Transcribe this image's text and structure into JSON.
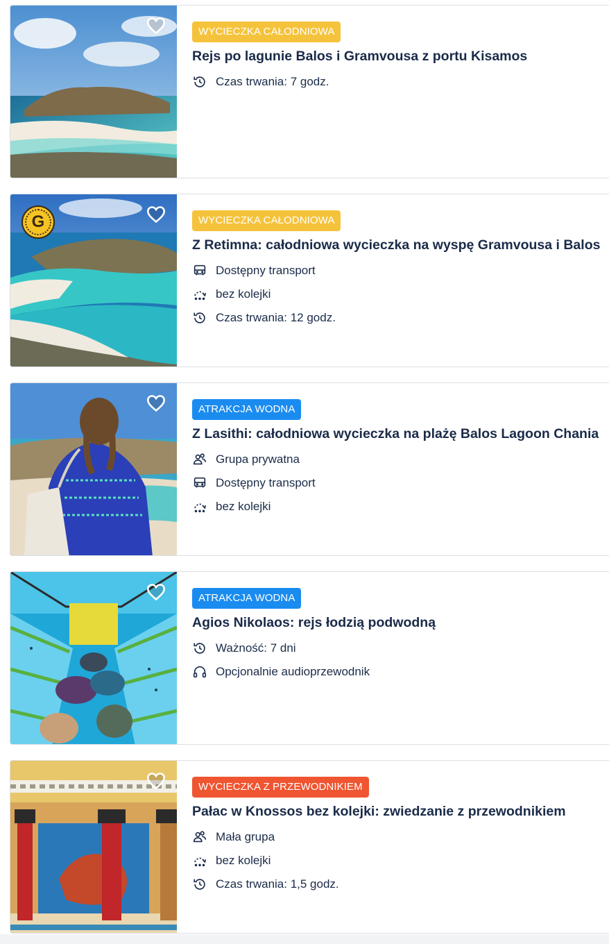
{
  "colors": {
    "tag_yellow": "#f5c33b",
    "tag_blue": "#1a8cf0",
    "tag_red": "#ef5531",
    "text": "#1a2b49"
  },
  "cards": [
    {
      "category": "WYCIECZKA CAŁODNIOWA",
      "category_color": "yellow",
      "title": "Rejs po lagunie Balos i Gramvousa z portu Kisamos",
      "image": "balos-lagoon-aerial",
      "badge": null,
      "features": [
        {
          "icon": "clock-icon",
          "text": "Czas trwania: 7 godz."
        }
      ]
    },
    {
      "category": "WYCIECZKA CAŁODNIOWA",
      "category_color": "yellow",
      "title": "Z Retimna: całodniowa wycieczka na wyspę Gramvousa i Balos",
      "image": "gramvousa-lagoon-aerial",
      "badge": "G",
      "features": [
        {
          "icon": "bus-icon",
          "text": "Dostępny transport"
        },
        {
          "icon": "skip-line-icon",
          "text": "bez kolejki"
        },
        {
          "icon": "clock-icon",
          "text": "Czas trwania: 12 godz."
        }
      ]
    },
    {
      "category": "ATRAKCJA WODNA",
      "category_color": "blue",
      "title": "Z Lasithi: całodniowa wycieczka na plażę Balos Lagoon Chania",
      "image": "woman-overlooking-balos",
      "badge": null,
      "features": [
        {
          "icon": "group-icon",
          "text": "Grupa prywatna"
        },
        {
          "icon": "bus-icon",
          "text": "Dostępny transport"
        },
        {
          "icon": "skip-line-icon",
          "text": "bez kolejki"
        }
      ]
    },
    {
      "category": "ATRAKCJA WODNA",
      "category_color": "blue",
      "title": "Agios Nikolaos: rejs łodzią podwodną",
      "image": "glass-bottom-boat-interior",
      "badge": null,
      "features": [
        {
          "icon": "clock-icon",
          "text": "Ważność: 7 dni"
        },
        {
          "icon": "headphones-icon",
          "text": "Opcjonalnie audioprzewodnik"
        }
      ]
    },
    {
      "category": "WYCIECZKA Z PRZEWODNIKIEM",
      "category_color": "red",
      "title": "Pałac w Knossos bez kolejki: zwiedzanie z przewodnikiem",
      "image": "knossos-palace-columns",
      "badge": null,
      "features": [
        {
          "icon": "group-icon",
          "text": "Mała grupa"
        },
        {
          "icon": "skip-line-icon",
          "text": "bez kolejki"
        },
        {
          "icon": "clock-icon",
          "text": "Czas trwania: 1,5 godz."
        }
      ]
    }
  ]
}
